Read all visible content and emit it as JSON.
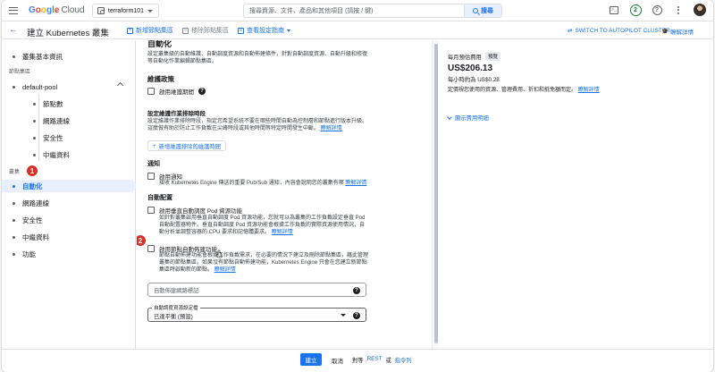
{
  "topbar": {
    "brand": "Google Cloud",
    "project": "terraform101",
    "search_placeholder": "搜尋資源、文件、產品和其他項目 (請按 / 鍵)",
    "search_button": "搜尋",
    "notification_count": "2",
    "terminal_glyph": ">_",
    "help_glyph": "?"
  },
  "subbar": {
    "back_glyph": "←",
    "title": "建立 Kubernetes 叢集",
    "add_node_pool": "新增節點集區",
    "remove_node_pool": "移除節點集區",
    "view_guide": "查看設定指南",
    "switch_autopilot": "SWITCH TO AUTOPILOT CLUSTER",
    "learn": "瞭解詳情"
  },
  "sidebar": {
    "cluster_basics": "叢集基本資訊",
    "node_pools_group": "節點集區",
    "default_pool": "default-pool",
    "pool_children": [
      "節點數",
      "網路連線",
      "安全性",
      "中繼資料"
    ],
    "cluster_group": "叢集",
    "cluster_items": [
      "自動化",
      "網路連線",
      "安全性",
      "中繼資料",
      "功能"
    ],
    "marker1": "1"
  },
  "main": {
    "section_title": "自動化",
    "intro": "設定叢集級的自動維護、自動調度資源和自動佈建條件，針對自動調度資源、自動升級和修復等自動化作業編輯節點集區。",
    "maintenance_heading": "維護政策",
    "enable_maintenance": "啟用維護期間",
    "exclusion_heading": "設定維護作業排除時段",
    "exclusion_desc": "設定維護作業排除時段，指定您希望系統不要在哪些時間自動為控制層和節點進行版本升級。這麼做有助於防止工作負載在尖峰時段或其他時間等特定時間發生中斷。",
    "learn_more": "瞭解詳情",
    "add_exclusion": "新增維護排除的維護時間",
    "notify_heading": "通知",
    "enable_notify": "啟用通知",
    "notify_desc": "接收 Kubernetes Engine 傳送的重要 Pub/Sub 通知，內容會說明您的叢集有哪",
    "autoscale_heading": "自動配置",
    "enable_vpa": "啟用垂直自動調度 Pod 資源功能",
    "vpa_desc": "如針對叢集啟用垂直自動調度 Pod 資源功能，您就可以為叢集的工作負載設定垂直 Pod 自動配置器物件。垂直自動調度 Pod 資源功能會根據工作負載的實際資源使用情況，自動分析並調整容器的 CPU 要求和記憶體要求。",
    "enable_nap": "啟用節點自動佈建功能",
    "nap_desc": "節點自動佈建功能會根據工作負載需求，在必要的情況下建立及刪除節點集區，藉此管理叢集的節點集區。如果沒有節點自動佈建功能，Kubernetes Engine 只會在您建立新節點集區時啟動新的節點。",
    "autoprovision_placeholder": "自動佈建網路標記",
    "profile_label": "自動調度資源設定檔",
    "profile_value": "已達平衡 (預設)",
    "marker2": "2"
  },
  "cost": {
    "label": "每月預估費用",
    "preview": "預覽",
    "amount": "US$206.13",
    "hourly": "每小時約為 US$0.28",
    "desc": "定價視您使用的資源、管理費用、折扣和抵免額而定。",
    "learn": "瞭解詳情",
    "expand": "顯示費用明細"
  },
  "footer": {
    "create": "建立",
    "cancel": "取消",
    "equivalent": "對等",
    "rest": "REST",
    "or": "或",
    "command_line": "指令列"
  },
  "colors": {
    "accent": "#1a73e8",
    "marker": "#d93025",
    "notification": "#188038"
  }
}
